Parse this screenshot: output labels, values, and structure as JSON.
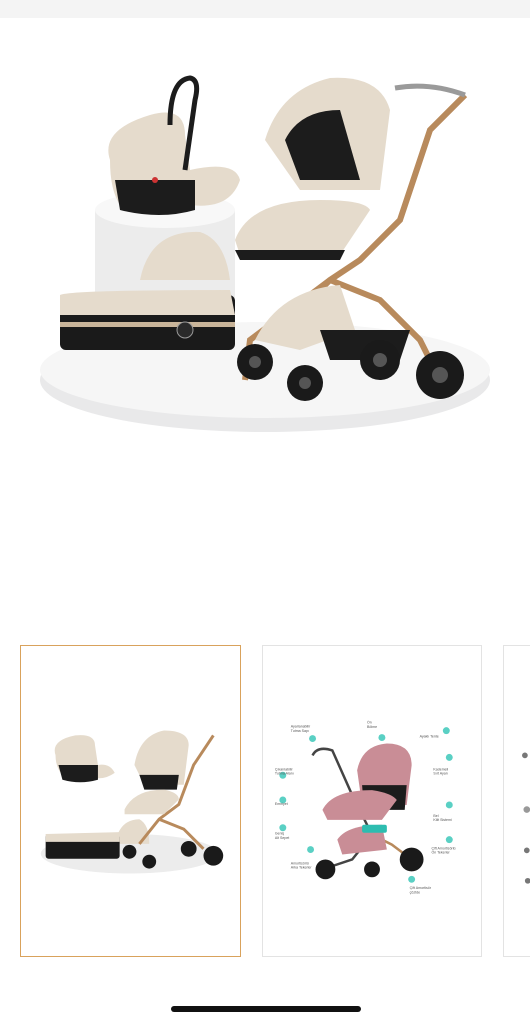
{
  "gallery": {
    "selected_index": 0,
    "thumbnails": [
      {
        "name": "stroller-set-thumbnail",
        "selected": true
      },
      {
        "name": "stroller-features-thumbnail",
        "selected": false
      },
      {
        "name": "stroller-partial-thumbnail",
        "selected": false
      }
    ]
  },
  "feature_callouts": [
    {
      "label": "Ayarlanabilir\nTutma Sapı"
    },
    {
      "label": "Ön\nBölme"
    },
    {
      "label": "Ayaklı Tente"
    },
    {
      "label": "Çıkarılabilir\nTutma Alanı"
    },
    {
      "label": "Kademeli\nSırt Ayarı"
    },
    {
      "label": "Emniyet"
    },
    {
      "label": "Bel\nKilit Sistemi"
    },
    {
      "label": "Geniş\nAlt Sepet"
    },
    {
      "label": "Amortisörlü\nArka Tekerler"
    },
    {
      "label": "Çift Amortisörlü\nÖn Tekerler"
    },
    {
      "label": "Çift Amortisör\nçöztde"
    }
  ],
  "colors": {
    "accent_border": "#d9a25c",
    "beige": "#e5dbcc",
    "pink": "#c98d96",
    "gold": "#b88a5c"
  }
}
